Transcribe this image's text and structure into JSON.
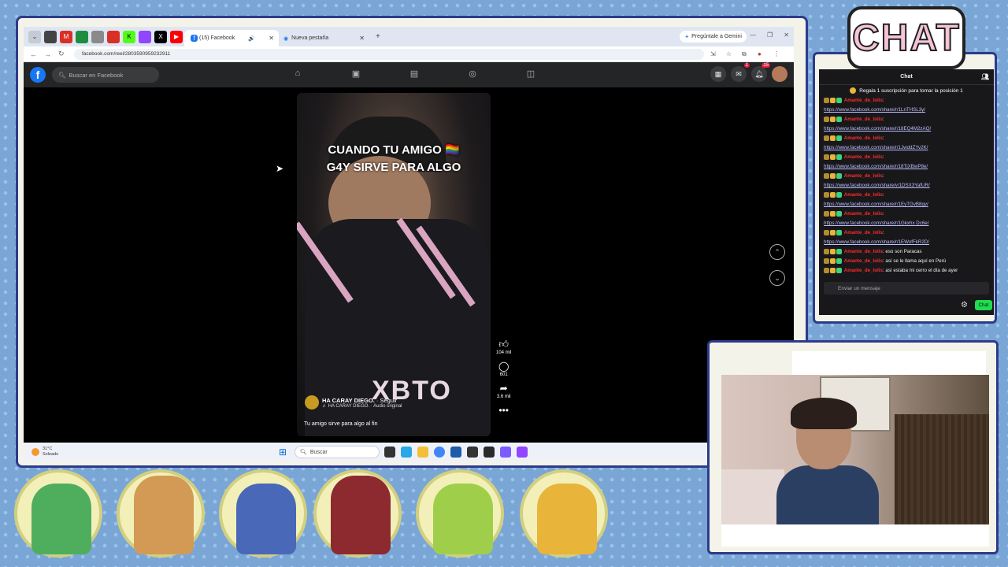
{
  "browser": {
    "tabs": [
      {
        "label": "(15) Facebook",
        "active": true
      },
      {
        "label": "Nueva pestaña",
        "active": false
      }
    ],
    "gemini_button": "Pregúntale a Gemini",
    "url": "facebook.com/reel/2803590959232911"
  },
  "facebook": {
    "search_placeholder": "Buscar en Facebook",
    "notification_badge": "15",
    "messenger_badge": "1"
  },
  "reel": {
    "caption_line1": "CUANDO TU AMIGO 🏳️‍🌈",
    "caption_line2": "G4Y SIRVE PARA ALGO",
    "shirt_text": "XBTO",
    "author": "HA CARAY DIEGO.",
    "follow": "· Seguir",
    "audio": "♬ HA CARAY DIEGO. · Audio original",
    "description": "Tu amigo sirve para algo al fin",
    "likes": "104 mil",
    "comments": "601",
    "shares": "3.6 mil"
  },
  "taskbar": {
    "temperature": "31°C",
    "weather": "Soleado",
    "search": "Buscar"
  },
  "chat": {
    "logo": "CHAT",
    "title": "Chat",
    "pinned": "Regala 1 suscripción para tomar la posición 1",
    "messages": [
      {
        "user": "Amante_de_lolis",
        "text": "https://www.facebook.com/share/r/1LnTHSL3y/",
        "link": true
      },
      {
        "user": "Amante_de_lolis",
        "text": "https://www.facebook.com/share/r/18EQ4M2zAQ/",
        "link": true
      },
      {
        "user": "Amante_de_lolis",
        "text": "https://www.facebook.com/share/r/1JwddZYv2K/",
        "link": true
      },
      {
        "user": "Amante_de_lolis",
        "text": "https://www.facebook.com/share/r/18TjXBwP8e/",
        "link": true
      },
      {
        "user": "Amante_de_lolis",
        "text": "https://www.facebook.com/share/v/1DSX3YafUR/",
        "link": true
      },
      {
        "user": "Amante_de_lolis",
        "text": "https://www.facebook.com/share/r/1EyTGvB8gv/",
        "link": true
      },
      {
        "user": "Amante_de_lolis",
        "text": "https://www.facebook.com/share/r/1Gkxhx Dc6e/",
        "link": true
      },
      {
        "user": "Amante_de_lolis",
        "text": "https://www.facebook.com/share/r/1EWofFkR2D/",
        "link": true
      },
      {
        "user": "Amante_de_lolis",
        "text": "eso son Paracas",
        "link": false
      },
      {
        "user": "Amante_de_lolis",
        "text": "así se le llama aquí en Perú",
        "link": false
      },
      {
        "user": "Amante_de_lolis",
        "text": "así estaba mi cerro el día de ayer",
        "link": false
      }
    ],
    "input_placeholder": "Enviar un mensaje",
    "send_label": "Chat"
  },
  "colors": {
    "fb_blue": "#1877f2",
    "chat_user": "#ff2a2a",
    "chat_button": "#1fdd52",
    "frame": "#2c3b8a"
  }
}
